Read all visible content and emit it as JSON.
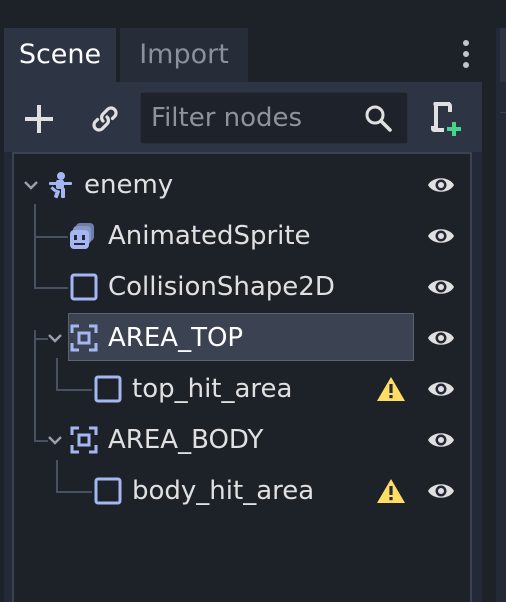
{
  "tabs": [
    {
      "label": "Scene",
      "active": true
    },
    {
      "label": "Import",
      "active": false
    }
  ],
  "toolbar": {
    "add_icon": "plus-icon",
    "link_icon": "link-icon",
    "filter_placeholder": "Filter nodes",
    "filter_value": "",
    "search_icon": "search-icon",
    "script_icon": "add-script-icon"
  },
  "tree": {
    "nodes": [
      {
        "label": "enemy",
        "icon": "kinematic-body-icon",
        "depth": 0,
        "expanded": true,
        "visible": true,
        "warning": false
      },
      {
        "label": "AnimatedSprite",
        "icon": "animated-sprite-icon",
        "depth": 1,
        "visible": true,
        "warning": false
      },
      {
        "label": "CollisionShape2D",
        "icon": "collision-shape-icon",
        "depth": 1,
        "visible": true,
        "warning": false
      },
      {
        "label": "AREA_TOP",
        "icon": "area2d-icon",
        "depth": 1,
        "expanded": true,
        "selected": true,
        "visible": true,
        "warning": false
      },
      {
        "label": "top_hit_area",
        "icon": "collision-shape-icon",
        "depth": 2,
        "visible": true,
        "warning": true
      },
      {
        "label": "AREA_BODY",
        "icon": "area2d-icon",
        "depth": 1,
        "expanded": true,
        "visible": true,
        "warning": false
      },
      {
        "label": "body_hit_area",
        "icon": "collision-shape-icon",
        "depth": 2,
        "visible": true,
        "warning": true
      }
    ]
  },
  "colors": {
    "node_blue": "#a5b7f3",
    "warning": "#ffdd65",
    "eye": "#e0e0e0",
    "selection": "#3b4352"
  }
}
